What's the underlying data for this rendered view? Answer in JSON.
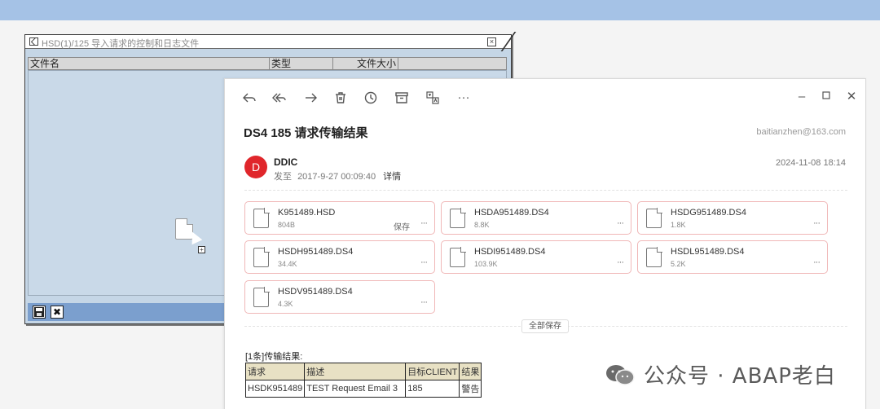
{
  "sap_dialog": {
    "title": "HSD(1)/125 导入请求的控制和日志文件",
    "columns": [
      "文件名",
      "类型",
      "文件大小"
    ],
    "footer_buttons": [
      "save-icon",
      "cancel-icon"
    ]
  },
  "mail": {
    "toolbar": [
      "reply-icon",
      "reply-all-icon",
      "forward-icon",
      "delete-icon",
      "clock-icon",
      "archive-icon",
      "translate-icon",
      "more-icon"
    ],
    "subject": "DS4 185 请求传输结果",
    "to_address": "baitianzhen@163.com",
    "sender": "DDIC",
    "avatar_letter": "D",
    "sent_prefix": "发至",
    "sent_time": "2017-9-27 00:09:40",
    "detail_link": "详情",
    "received_time": "2024-11-08 18:14",
    "attachments": [
      {
        "name": "K951489.HSD",
        "size": "804B",
        "save": "保存",
        "more": "···"
      },
      {
        "name": "HSDA951489.DS4",
        "size": "8.8K",
        "save": "",
        "more": "···"
      },
      {
        "name": "HSDG951489.DS4",
        "size": "1.8K",
        "save": "",
        "more": "···"
      },
      {
        "name": "HSDH951489.DS4",
        "size": "34.4K",
        "save": "",
        "more": "···"
      },
      {
        "name": "HSDI951489.DS4",
        "size": "103.9K",
        "save": "",
        "more": "···"
      },
      {
        "name": "HSDL951489.DS4",
        "size": "5.2K",
        "save": "",
        "more": "···"
      },
      {
        "name": "HSDV951489.DS4",
        "size": "4.3K",
        "save": "",
        "more": "···"
      }
    ],
    "save_all": "全部保存",
    "result_title": "[1条]传输结果:",
    "result_table": {
      "headers": [
        "请求",
        "描述",
        "目标CLIENT",
        "结果"
      ],
      "rows": [
        [
          "HSDK951489",
          "TEST Request Email 3",
          "185",
          "警告"
        ]
      ]
    }
  },
  "watermark": "公众号 · ABAP老白"
}
